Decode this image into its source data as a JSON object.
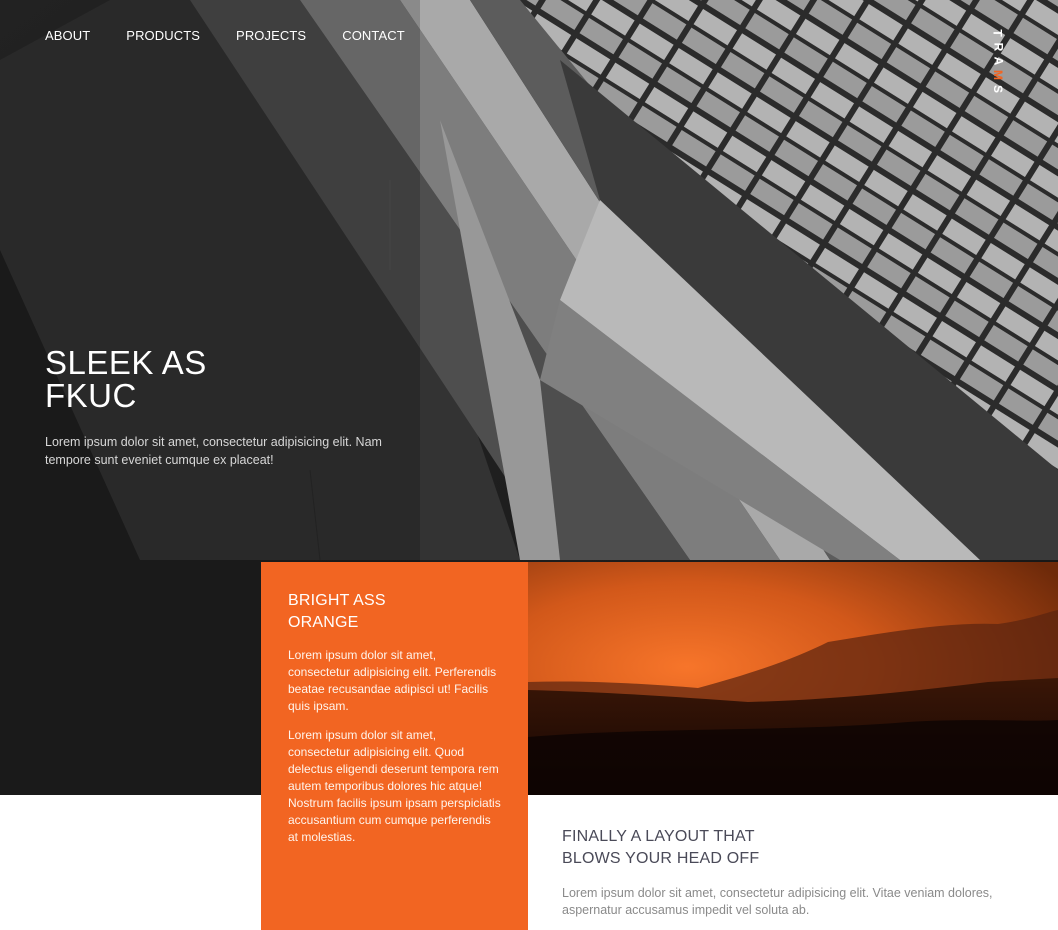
{
  "nav": {
    "items": [
      {
        "label": "ABOUT"
      },
      {
        "label": "PRODUCTS"
      },
      {
        "label": "PROJECTS"
      },
      {
        "label": "CONTACT"
      }
    ]
  },
  "logo": {
    "letters": [
      "T",
      "R",
      "A",
      "M",
      "S"
    ],
    "accent_color": "#f26522"
  },
  "hero": {
    "title_line1": "SLEEK AS",
    "title_line2": "FKUC",
    "text": "Lorem ipsum dolor sit amet, consectetur adipisicing elit. Nam tempore sunt eveniet cumque ex placeat!"
  },
  "card": {
    "title_line1": "BRIGHT ASS",
    "title_line2": "ORANGE",
    "paragraph1": "Lorem ipsum dolor sit amet, consectetur adipisicing elit. Perferendis beatae recusandae adipisci ut! Facilis quis ipsam.",
    "paragraph2": "Lorem ipsum dolor sit amet, consectetur adipisicing elit. Quod delectus eligendi deserunt tempora rem autem temporibus dolores hic atque! Nostrum facilis ipsum ipsam perspiciatis accusantium cum cumque perferendis at molestias.",
    "color": "#f26522"
  },
  "feature": {
    "title_line1": "FINALLY A LAYOUT THAT",
    "title_line2": "BLOWS YOUR HEAD OFF",
    "text": "Lorem ipsum dolor sit amet, consectetur adipisicing elit. Vitae veniam dolores, aspernatur accusamus impedit vel soluta ab."
  }
}
